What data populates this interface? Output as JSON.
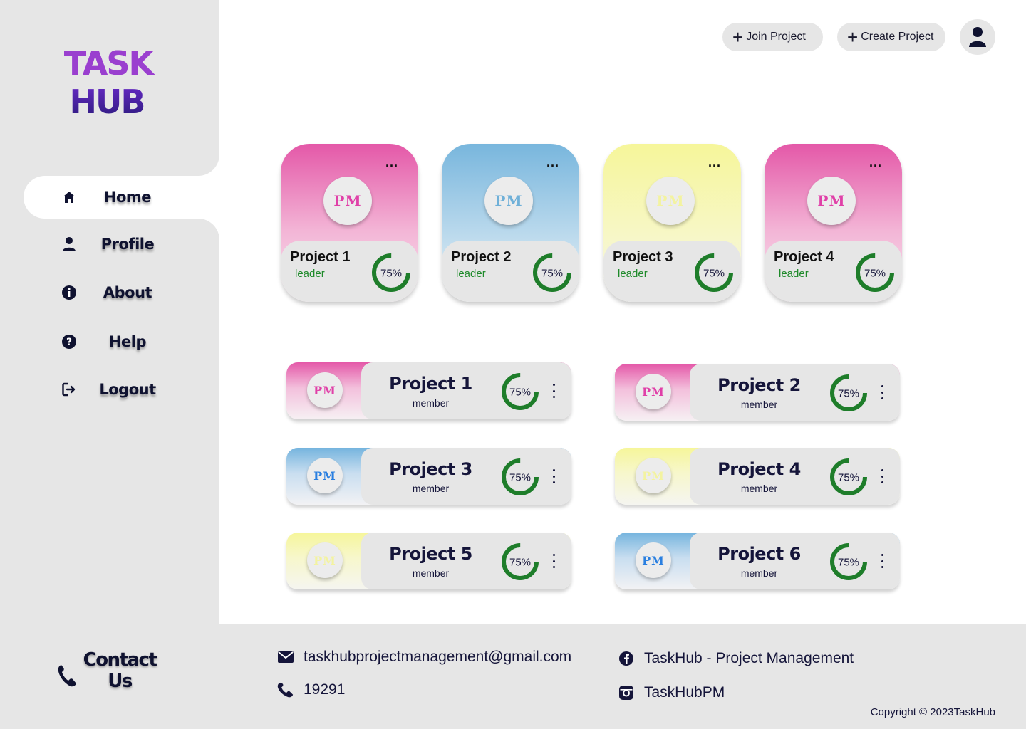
{
  "brand": {
    "line1": "TASK",
    "line2": "HUB"
  },
  "nav": [
    {
      "label": "Home",
      "icon": "home-icon"
    },
    {
      "label": "Profile",
      "icon": "user-icon"
    },
    {
      "label": "About",
      "icon": "info-icon"
    },
    {
      "label": "Help",
      "icon": "help-icon"
    },
    {
      "label": "Logout",
      "icon": "logout-icon"
    }
  ],
  "header": {
    "join_label": "Join Project",
    "create_label": "Create Project"
  },
  "leader_projects": [
    {
      "title": "Project 1",
      "role": "leader",
      "progress": "75%",
      "progress_value": 0.75,
      "theme": "pink",
      "initials": "PM",
      "menu": "..."
    },
    {
      "title": "Project 2",
      "role": "leader",
      "progress": "75%",
      "progress_value": 0.75,
      "theme": "blue",
      "initials": "PM",
      "menu": "..."
    },
    {
      "title": "Project 3",
      "role": "leader",
      "progress": "75%",
      "progress_value": 0.75,
      "theme": "yellow",
      "initials": "PM",
      "menu": "..."
    },
    {
      "title": "Project 4",
      "role": "leader",
      "progress": "75%",
      "progress_value": 0.75,
      "theme": "pink",
      "initials": "PM",
      "menu": "..."
    }
  ],
  "member_projects": [
    {
      "title": "Project 1",
      "role": "member",
      "progress": "75%",
      "progress_value": 0.75,
      "theme": "pink",
      "initials": "PM"
    },
    {
      "title": "Project 2",
      "role": "member",
      "progress": "75%",
      "progress_value": 0.75,
      "theme": "pink",
      "initials": "PM"
    },
    {
      "title": "Project 3",
      "role": "member",
      "progress": "75%",
      "progress_value": 0.75,
      "theme": "blue",
      "initials": "PM"
    },
    {
      "title": "Project 4",
      "role": "member",
      "progress": "75%",
      "progress_value": 0.75,
      "theme": "yellow",
      "initials": "PM"
    },
    {
      "title": "Project 5",
      "role": "member",
      "progress": "75%",
      "progress_value": 0.75,
      "theme": "yellow",
      "initials": "PM"
    },
    {
      "title": "Project 6",
      "role": "member",
      "progress": "75%",
      "progress_value": 0.75,
      "theme": "blue",
      "initials": "PM"
    }
  ],
  "footer": {
    "contact_line1": "Contact",
    "contact_line2": "Us",
    "email": "taskhubprojectmanagement@gmail.com",
    "phone": "19291",
    "facebook": "TaskHub - Project Management",
    "instagram": "TaskHubPM",
    "copyright": "Copyright © 2023TaskHub"
  },
  "colors": {
    "sidebar_bg": "#e6e6e6",
    "progress_ring": "#1e7d2a",
    "role_text": "#1e8a2a",
    "pink": "#e05aa8",
    "blue": "#7db8dc",
    "yellow": "#f5f5a0",
    "navy": "#0f1230"
  }
}
